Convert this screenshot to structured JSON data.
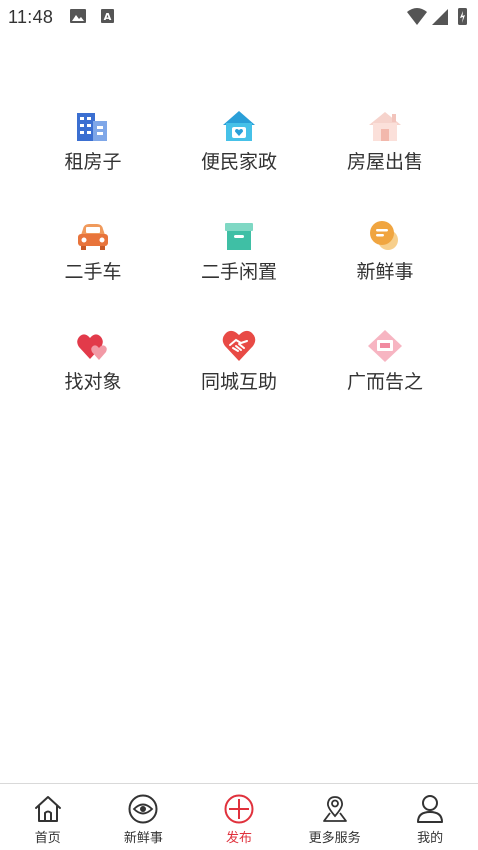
{
  "status_bar": {
    "time": "11:48",
    "icons": [
      "image-icon",
      "a-icon",
      "wifi-icon",
      "signal-icon",
      "battery-icon"
    ]
  },
  "services": [
    {
      "label": "租房子",
      "icon": "building-icon",
      "color": "#3b6fd1"
    },
    {
      "label": "便民家政",
      "icon": "house-heart-icon",
      "color": "#2a9fd8"
    },
    {
      "label": "房屋出售",
      "icon": "house-icon",
      "color": "#f2c4bc"
    },
    {
      "label": "二手车",
      "icon": "car-icon",
      "color": "#e8743b"
    },
    {
      "label": "二手闲置",
      "icon": "box-icon",
      "color": "#3fbfa5"
    },
    {
      "label": "新鲜事",
      "icon": "chat-bubble-icon",
      "color": "#f0a540"
    },
    {
      "label": "找对象",
      "icon": "hearts-icon",
      "color": "#e23a4a"
    },
    {
      "label": "同城互助",
      "icon": "handshake-heart-icon",
      "color": "#e84a45"
    },
    {
      "label": "广而告之",
      "icon": "diamond-sign-icon",
      "color": "#f18aa0"
    }
  ],
  "nav": [
    {
      "label": "首页",
      "icon": "home-icon"
    },
    {
      "label": "新鲜事",
      "icon": "eye-icon"
    },
    {
      "label": "发布",
      "icon": "plus-circle-icon",
      "active": true
    },
    {
      "label": "更多服务",
      "icon": "location-icon"
    },
    {
      "label": "我的",
      "icon": "person-icon"
    }
  ],
  "colors": {
    "accent": "#e0313c",
    "text": "#333333"
  }
}
